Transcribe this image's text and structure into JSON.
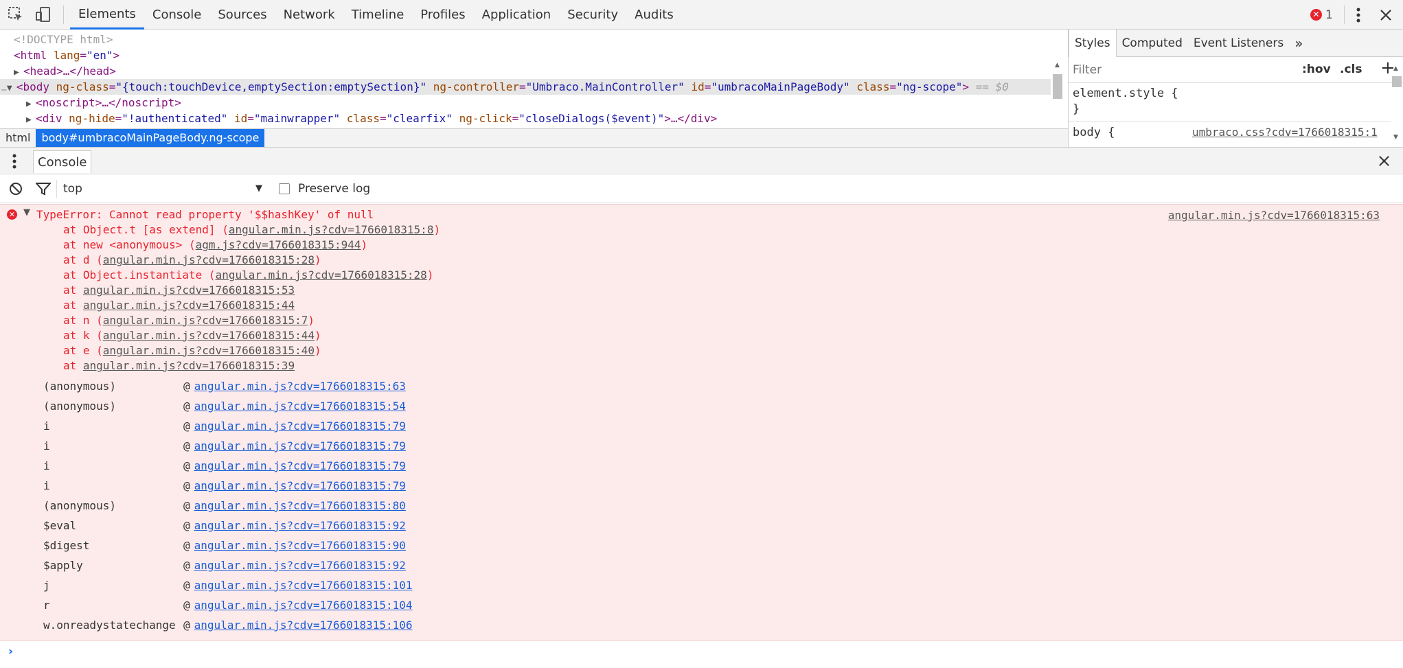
{
  "toolbar": {
    "tabs": [
      "Elements",
      "Console",
      "Sources",
      "Network",
      "Timeline",
      "Profiles",
      "Application",
      "Security",
      "Audits"
    ],
    "error_count": "1"
  },
  "elements": {
    "doctype": "<!DOCTYPE html>",
    "html_open": "<html",
    "html_attr_n": "lang",
    "html_attr_v": "\"en\"",
    "head_line": "<head>…</head>",
    "body_tag": "<body",
    "body_attrs": [
      {
        "n": "ng-class",
        "v": "\"{touch:touchDevice,emptySection:emptySection}\""
      },
      {
        "n": "ng-controller",
        "v": "\"Umbraco.MainController\""
      },
      {
        "n": "id",
        "v": "\"umbracoMainPageBody\""
      },
      {
        "n": "class",
        "v": "\"ng-scope\""
      }
    ],
    "body_suffix": "== $0",
    "noscript_line": "<noscript>…</noscript>",
    "div_tag": "<div",
    "div_attrs": [
      {
        "n": "ng-hide",
        "v": "\"!authenticated\""
      },
      {
        "n": "id",
        "v": "\"mainwrapper\""
      },
      {
        "n": "class",
        "v": "\"clearfix\""
      },
      {
        "n": "ng-click",
        "v": "\"closeDialogs($event)\""
      }
    ],
    "div_close": ">…</div>"
  },
  "breadcrumb": [
    "html",
    "body#umbracoMainPageBody.ng-scope"
  ],
  "styles": {
    "tabs": [
      "Styles",
      "Computed",
      "Event Listeners"
    ],
    "filter_placeholder": "Filter",
    "hov": ":hov",
    "cls": ".cls",
    "element_style": "element.style {",
    "close_brace": "}",
    "body_rule": "body {",
    "body_source": "umbraco.css?cdv=1766018315:1"
  },
  "drawer": {
    "tab": "Console"
  },
  "console_toolbar": {
    "context": "top",
    "preserve_log": "Preserve log"
  },
  "error": {
    "message": "TypeError: Cannot read property '$$hashKey' of null",
    "source": "angular.min.js?cdv=1766018315:63",
    "trace": [
      {
        "pre": "at Object.t [as extend] (",
        "link": "angular.min.js?cdv=1766018315:8",
        "post": ")"
      },
      {
        "pre": "at new <anonymous> (",
        "link": "agm.js?cdv=1766018315:944",
        "post": ")"
      },
      {
        "pre": "at d (",
        "link": "angular.min.js?cdv=1766018315:28",
        "post": ")"
      },
      {
        "pre": "at Object.instantiate (",
        "link": "angular.min.js?cdv=1766018315:28",
        "post": ")"
      },
      {
        "pre": "at ",
        "link": "angular.min.js?cdv=1766018315:53",
        "post": ""
      },
      {
        "pre": "at ",
        "link": "angular.min.js?cdv=1766018315:44",
        "post": ""
      },
      {
        "pre": "at n (",
        "link": "angular.min.js?cdv=1766018315:7",
        "post": ")"
      },
      {
        "pre": "at k (",
        "link": "angular.min.js?cdv=1766018315:44",
        "post": ")"
      },
      {
        "pre": "at e (",
        "link": "angular.min.js?cdv=1766018315:40",
        "post": ")"
      },
      {
        "pre": "at ",
        "link": "angular.min.js?cdv=1766018315:39",
        "post": ""
      }
    ],
    "stack": [
      {
        "fn": "(anonymous)",
        "link": "angular.min.js?cdv=1766018315:63"
      },
      {
        "fn": "(anonymous)",
        "link": "angular.min.js?cdv=1766018315:54"
      },
      {
        "fn": "i",
        "link": "angular.min.js?cdv=1766018315:79"
      },
      {
        "fn": "i",
        "link": "angular.min.js?cdv=1766018315:79"
      },
      {
        "fn": "i",
        "link": "angular.min.js?cdv=1766018315:79"
      },
      {
        "fn": "i",
        "link": "angular.min.js?cdv=1766018315:79"
      },
      {
        "fn": "(anonymous)",
        "link": "angular.min.js?cdv=1766018315:80"
      },
      {
        "fn": "$eval",
        "link": "angular.min.js?cdv=1766018315:92"
      },
      {
        "fn": "$digest",
        "link": "angular.min.js?cdv=1766018315:90"
      },
      {
        "fn": "$apply",
        "link": "angular.min.js?cdv=1766018315:92"
      },
      {
        "fn": "j",
        "link": "angular.min.js?cdv=1766018315:101"
      },
      {
        "fn": "r",
        "link": "angular.min.js?cdv=1766018315:104"
      },
      {
        "fn": "w.onreadystatechange",
        "link": "angular.min.js?cdv=1766018315:106"
      }
    ],
    "at_sign": "@"
  },
  "colors": {
    "accent": "#1a73e8",
    "error_text": "#e8232e",
    "error_bg": "#fdebeb",
    "link": "#1a5cd8"
  }
}
